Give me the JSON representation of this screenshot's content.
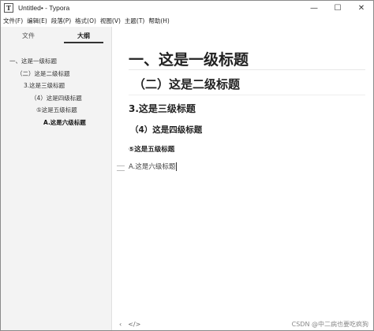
{
  "window": {
    "app_icon": "T",
    "title": "Untitled• - Typora",
    "controls": {
      "minimize": "—",
      "maximize": "☐",
      "close": "✕"
    }
  },
  "menu": [
    "文件(F)",
    "编辑(E)",
    "段落(P)",
    "格式(O)",
    "视图(V)",
    "主题(T)",
    "帮助(H)"
  ],
  "sidebar": {
    "tabs": [
      {
        "label": "文件",
        "active": false
      },
      {
        "label": "大纲",
        "active": true
      }
    ],
    "outline": [
      {
        "label": "一、这是一级标题",
        "level": 1
      },
      {
        "label": "（二）这是二级标题",
        "level": 2
      },
      {
        "label": "3.这是三级标题",
        "level": 3
      },
      {
        "label": "（4）这是四级标题",
        "level": 4
      },
      {
        "label": "⑤这是五级标题",
        "level": 5
      },
      {
        "label": "A.这是六级标题",
        "level": 6,
        "active": true
      }
    ]
  },
  "editor": {
    "h1": "一、这是一级标题",
    "h2": "（二）这是二级标题",
    "h3": "3.这是三级标题",
    "h4": "（4）这是四级标题",
    "h5": "⑤这是五级标题",
    "h6": "A.这是六级标题"
  },
  "statusbar": {
    "back_icon": "‹",
    "source_icon": "</>",
    "watermark": "CSDN @中二病也要吃疯狗"
  }
}
